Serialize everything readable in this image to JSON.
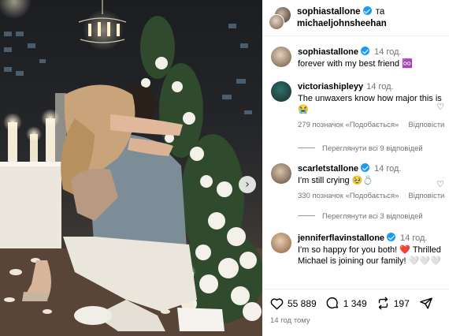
{
  "post": {
    "authors": [
      "sophiastallone",
      "michaeljohnsheehan"
    ],
    "authors_joiner": "та",
    "caption_user": "sophiastallone",
    "caption_time": "14 год.",
    "caption_text": "forever with my best friend ♾️",
    "likes": "55 889",
    "comments_count": "1 349",
    "reposts": "197",
    "posted_ago": "14 год тому"
  },
  "comments": [
    {
      "user": "victoriashipleyy",
      "verified": false,
      "time": "14 год.",
      "text": "The unwaxers know how major this is 😭",
      "likes": "279 позначок «Подобається»",
      "reply": "Відповісти",
      "view_replies": "Переглянути всі 9 відповідей"
    },
    {
      "user": "scarletstallone",
      "verified": true,
      "time": "14 год.",
      "text": "I'm still crying 🥹💍",
      "likes": "330 позначок «Подобається»",
      "reply": "Відповісти",
      "view_replies": "Переглянути всі 3 відповідей"
    },
    {
      "user": "jenniferflavinstallone",
      "verified": true,
      "time": "14 год.",
      "text": "I'm so happy for you both! ❤️ Thrilled Michael is joining our family! 🤍🤍🤍"
    }
  ],
  "icons": {
    "next": "chevron-right-icon",
    "verified": "verified-badge-icon",
    "like": "heart-icon",
    "comment": "comment-bubble-icon",
    "repost": "repost-icon",
    "share": "send-icon"
  },
  "colors": {
    "verified": "#1d9bf0",
    "muted": "#737373"
  }
}
